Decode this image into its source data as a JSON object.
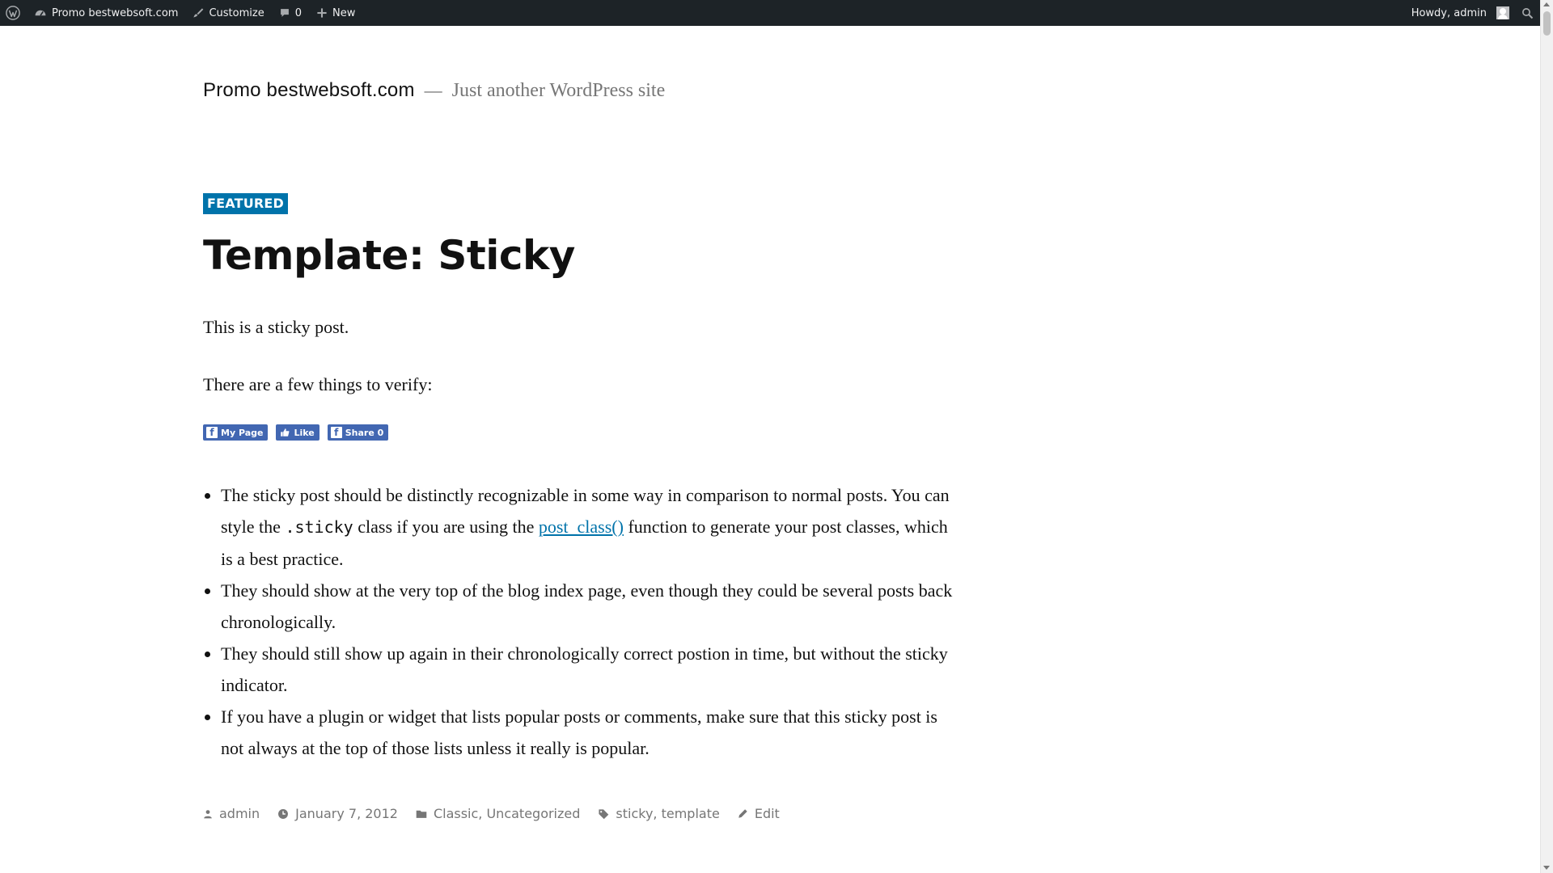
{
  "admin_bar": {
    "site_name": "Promo bestwebsoft.com",
    "customize": "Customize",
    "comments_count": "0",
    "new": "New",
    "greeting": "Howdy, admin"
  },
  "site": {
    "title": "Promo bestwebsoft.com",
    "separator": "—",
    "description": "Just another WordPress site"
  },
  "post": {
    "badge": "FEATURED",
    "title": "Template: Sticky",
    "paragraph1": "This is a sticky post.",
    "paragraph2": "There are a few things to verify:",
    "share_buttons": {
      "my_page": "My Page",
      "like": "Like",
      "share": "Share 0"
    },
    "list": {
      "item1_before_code": "The sticky post should be distinctly recognizable in some way in comparison to normal posts. You can style the ",
      "item1_code": ".sticky",
      "item1_middle": " class if you are using the ",
      "item1_link": "post_class()",
      "item1_after": " function to generate your post classes, which is a best practice.",
      "item2": "They should show at the very top of the blog index page, even though they could be several posts back chronologically.",
      "item3": "They should still show up again in their chronologically correct postion in time, but without the sticky indicator.",
      "item4": "If you have a plugin or widget that lists popular posts or comments, make sure that this sticky post is not always at the top of those lists unless it really is popular."
    },
    "footer": {
      "author": "admin",
      "date": "January 7, 2012",
      "categories": "Classic, Uncategorized",
      "tags": "sticky, template",
      "edit": "Edit"
    }
  },
  "colors": {
    "admin_bar_bg": "#1d2327",
    "accent": "#0073aa",
    "facebook": "#4267b2",
    "meta_text": "#767676"
  },
  "icons": [
    "wordpress-logo-icon",
    "dashboard-icon",
    "brush-icon",
    "comment-icon",
    "plus-icon",
    "avatar",
    "search-icon",
    "facebook-icon",
    "thumbs-up-icon",
    "person-icon",
    "clock-icon",
    "folder-icon",
    "tag-icon",
    "pencil-icon"
  ]
}
